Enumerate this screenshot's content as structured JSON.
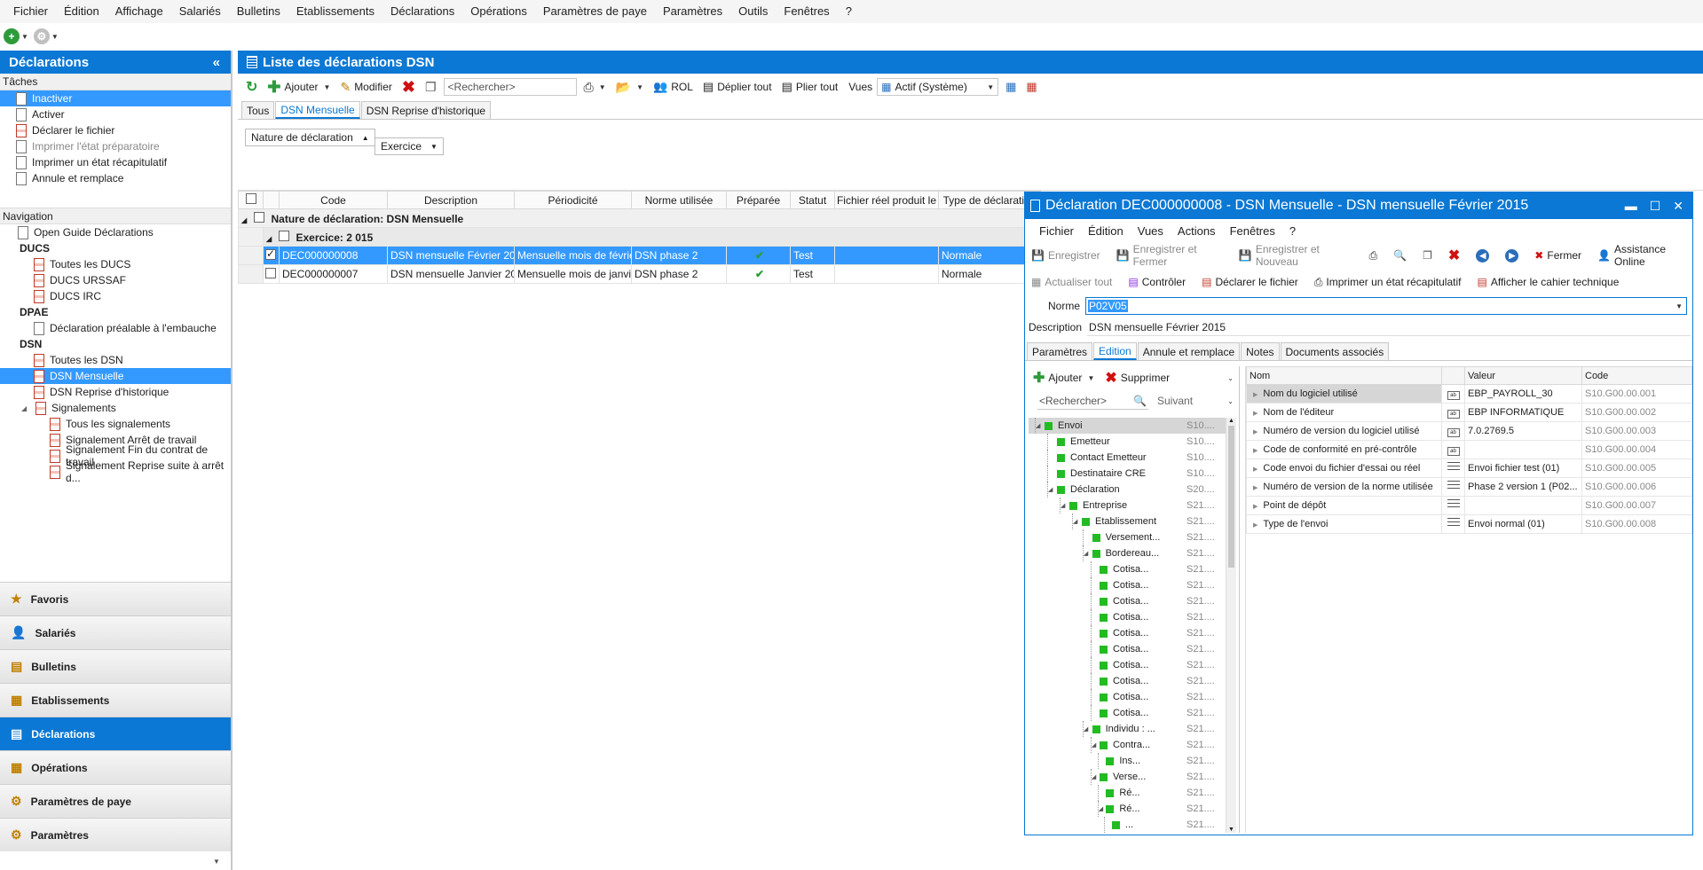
{
  "menubar": [
    "Fichier",
    "Édition",
    "Affichage",
    "Salariés",
    "Bulletins",
    "Etablissements",
    "Déclarations",
    "Opérations",
    "Paramètres de paye",
    "Paramètres",
    "Outils",
    "Fenêtres",
    "?"
  ],
  "left": {
    "title": "Déclarations",
    "tasks_header": "Tâches",
    "tasks": [
      {
        "label": "Inactiver",
        "selected": true
      },
      {
        "label": "Activer"
      },
      {
        "label": "Déclarer le fichier"
      },
      {
        "label": "Imprimer l'état préparatoire",
        "disabled": true
      },
      {
        "label": "Imprimer un état récapitulatif"
      },
      {
        "label": "Annule et remplace"
      }
    ],
    "nav_header": "Navigation",
    "nav": {
      "open_guide": "Open Guide Déclarations",
      "ducs_group": "DUCS",
      "ducs": [
        "Toutes les DUCS",
        "DUCS URSSAF",
        "DUCS IRC"
      ],
      "dpae_group": "DPAE",
      "dpae": [
        "Déclaration préalable à l'embauche"
      ],
      "dsn_group": "DSN",
      "dsn": [
        "Toutes les DSN",
        "DSN Mensuelle",
        "DSN Reprise d'historique"
      ],
      "signalements": "Signalements",
      "signalements_items": [
        "Tous les signalements",
        "Signalement Arrêt de travail",
        "Signalement Fin du contrat de travail",
        "Signalement Reprise suite à arrêt d..."
      ]
    },
    "bottom": [
      "Favoris",
      "Salariés",
      "Bulletins",
      "Etablissements",
      "Déclarations",
      "Opérations",
      "Paramètres de paye",
      "Paramètres"
    ]
  },
  "main": {
    "title": "Liste des déclarations DSN",
    "toolbar": {
      "add": "Ajouter",
      "edit": "Modifier",
      "search": "<Rechercher>",
      "rol": "ROL",
      "expand": "Déplier tout",
      "collapse": "Plier tout",
      "views": "Vues",
      "view_value": "Actif (Système)"
    },
    "tabs": [
      "Tous",
      "DSN Mensuelle",
      "DSN Reprise d'historique"
    ],
    "group_chips": [
      "Nature de déclaration",
      "Exercice"
    ],
    "columns": [
      "Code",
      "Description",
      "Périodicité",
      "Norme utilisée",
      "Préparée",
      "Statut",
      "Fichier réel produit le",
      "Type de déclaration"
    ],
    "group1": "Nature de déclaration: DSN Mensuelle",
    "group2": "Exercice: 2 015",
    "rows": [
      {
        "code": "DEC000000008",
        "description": "DSN mensuelle Février 2015",
        "periodicite": "Mensuelle mois de février",
        "norme": "DSN phase 2",
        "statut": "Test",
        "fichier": "",
        "type": "Normale",
        "selected": true
      },
      {
        "code": "DEC000000007",
        "description": "DSN mensuelle Janvier 2015",
        "periodicite": "Mensuelle mois de janvier",
        "norme": "DSN phase 2",
        "statut": "Test",
        "fichier": "",
        "type": "Normale"
      }
    ]
  },
  "dialog": {
    "title": "Déclaration DEC000000008  - DSN Mensuelle - DSN mensuelle Février 2015",
    "menu": [
      "Fichier",
      "Édition",
      "Vues",
      "Actions",
      "Fenêtres",
      "?"
    ],
    "toolbar1": {
      "save": "Enregistrer",
      "save_close": "Enregistrer et Fermer",
      "save_new": "Enregistrer et Nouveau",
      "close": "Fermer",
      "help": "Assistance Online"
    },
    "toolbar2": {
      "refresh": "Actualiser tout",
      "check": "Contrôler",
      "declare": "Déclarer le fichier",
      "print": "Imprimer un état récapitulatif",
      "spec": "Afficher le cahier technique"
    },
    "norme_label": "Norme",
    "norme_value": "P02V05",
    "description_label": "Description",
    "description_value": "DSN mensuelle Février 2015",
    "tabs": [
      "Paramètres",
      "Edition",
      "Annule et remplace",
      "Notes",
      "Documents associés"
    ],
    "tree_toolbar": {
      "add": "Ajouter",
      "delete": "Supprimer",
      "search": "<Rechercher>",
      "next": "Suivant"
    },
    "tree": [
      {
        "label": "Envoi",
        "code": "S10....",
        "level": 0
      },
      {
        "label": "Emetteur",
        "code": "S10....",
        "level": 1
      },
      {
        "label": "Contact Emetteur",
        "code": "S10....",
        "level": 1
      },
      {
        "label": "Destinataire CRE",
        "code": "S10....",
        "level": 1
      },
      {
        "label": "Déclaration",
        "code": "S20....",
        "level": 1
      },
      {
        "label": "Entreprise",
        "code": "S21....",
        "level": 2
      },
      {
        "label": "Etablissement",
        "code": "S21....",
        "level": 3
      },
      {
        "label": "Versement...",
        "code": "S21....",
        "level": 4
      },
      {
        "label": "Bordereau...",
        "code": "S21....",
        "level": 4
      },
      {
        "label": "Cotisa...",
        "code": "S21....",
        "level": 5
      },
      {
        "label": "Cotisa...",
        "code": "S21....",
        "level": 5
      },
      {
        "label": "Cotisa...",
        "code": "S21....",
        "level": 5
      },
      {
        "label": "Cotisa...",
        "code": "S21....",
        "level": 5
      },
      {
        "label": "Cotisa...",
        "code": "S21....",
        "level": 5
      },
      {
        "label": "Cotisa...",
        "code": "S21....",
        "level": 5
      },
      {
        "label": "Cotisa...",
        "code": "S21....",
        "level": 5
      },
      {
        "label": "Cotisa...",
        "code": "S21....",
        "level": 5
      },
      {
        "label": "Cotisa...",
        "code": "S21....",
        "level": 5
      },
      {
        "label": "Cotisa...",
        "code": "S21....",
        "level": 5
      },
      {
        "label": "Individu : ...",
        "code": "S21....",
        "level": 4
      },
      {
        "label": "Contra...",
        "code": "S21....",
        "level": 5
      },
      {
        "label": "Ins...",
        "code": "S21....",
        "level": 6
      },
      {
        "label": "Verse...",
        "code": "S21....",
        "level": 5
      },
      {
        "label": "Ré...",
        "code": "S21....",
        "level": 6
      },
      {
        "label": "Ré...",
        "code": "S21....",
        "level": 6
      },
      {
        "label": "...",
        "code": "S21....",
        "level": 7
      }
    ],
    "props_columns": [
      "Nom",
      "Valeur",
      "Code"
    ],
    "props": [
      {
        "nom": "Nom du logiciel utilisé",
        "valeur": "EBP_PAYROLL_30",
        "code": "S10.G00.00.001",
        "kind": "text"
      },
      {
        "nom": "Nom de l'éditeur",
        "valeur": "EBP INFORMATIQUE",
        "code": "S10.G00.00.002",
        "kind": "text"
      },
      {
        "nom": "Numéro de version du logiciel utilisé",
        "valeur": "7.0.2769.5",
        "code": "S10.G00.00.003",
        "kind": "text"
      },
      {
        "nom": "Code de conformité en pré-contrôle",
        "valeur": "",
        "code": "S10.G00.00.004",
        "kind": "text"
      },
      {
        "nom": "Code envoi du fichier d'essai ou réel",
        "valeur": "Envoi fichier test (01)",
        "code": "S10.G00.00.005",
        "kind": "list"
      },
      {
        "nom": "Numéro de version de la norme utilisée",
        "valeur": "Phase 2 version 1 (P02...",
        "code": "S10.G00.00.006",
        "kind": "list"
      },
      {
        "nom": "Point de dépôt",
        "valeur": "",
        "code": "S10.G00.00.007",
        "kind": "list"
      },
      {
        "nom": "Type de l'envoi",
        "valeur": "Envoi normal (01)",
        "code": "S10.G00.00.008",
        "kind": "list"
      }
    ]
  }
}
